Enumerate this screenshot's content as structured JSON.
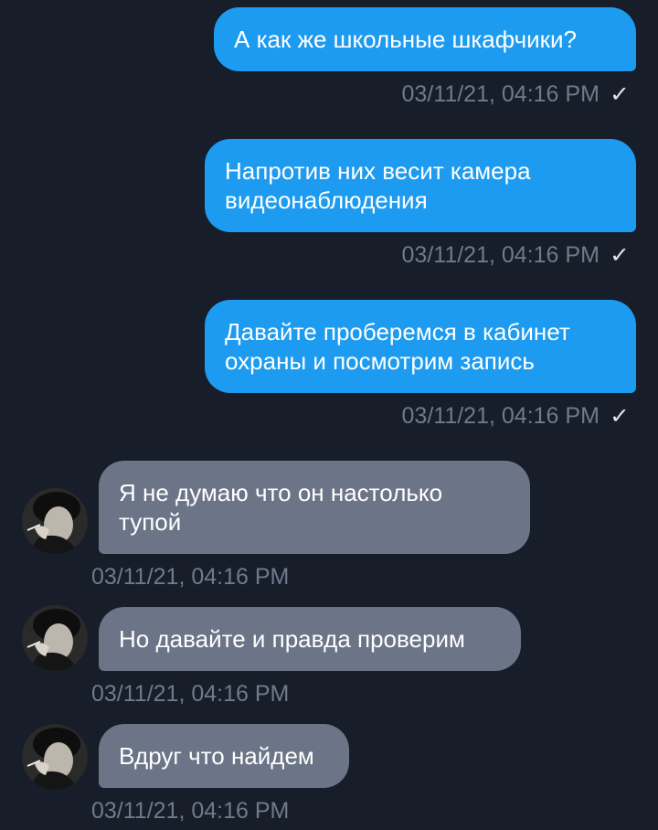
{
  "messages": [
    {
      "direction": "outgoing",
      "text": "А как же школьные шкафчики?",
      "timestamp": "03/11/21, 04:16 PM",
      "status_icon": "check-icon"
    },
    {
      "direction": "outgoing",
      "text": "Напротив них весит камера видеонаблюдения",
      "timestamp": "03/11/21, 04:16 PM",
      "status_icon": "check-icon"
    },
    {
      "direction": "outgoing",
      "text": "Давайте проберемся в кабинет охраны и посмотрим запись",
      "timestamp": "03/11/21, 04:16 PM",
      "status_icon": "check-icon"
    },
    {
      "direction": "incoming",
      "text": "Я не думаю что он настолько тупой",
      "timestamp": "03/11/21, 04:16 PM",
      "avatar_icon": "user-avatar"
    },
    {
      "direction": "incoming",
      "text": "Но давайте и правда проверим",
      "timestamp": "03/11/21, 04:16 PM",
      "avatar_icon": "user-avatar"
    },
    {
      "direction": "incoming",
      "text": "Вдруг что найдем",
      "timestamp": "03/11/21, 04:16 PM",
      "avatar_icon": "user-avatar"
    }
  ],
  "colors": {
    "background": "#171d29",
    "outgoing_bubble": "#1d9bf0",
    "incoming_bubble": "#6b7587",
    "timestamp": "#6f7a8c"
  }
}
